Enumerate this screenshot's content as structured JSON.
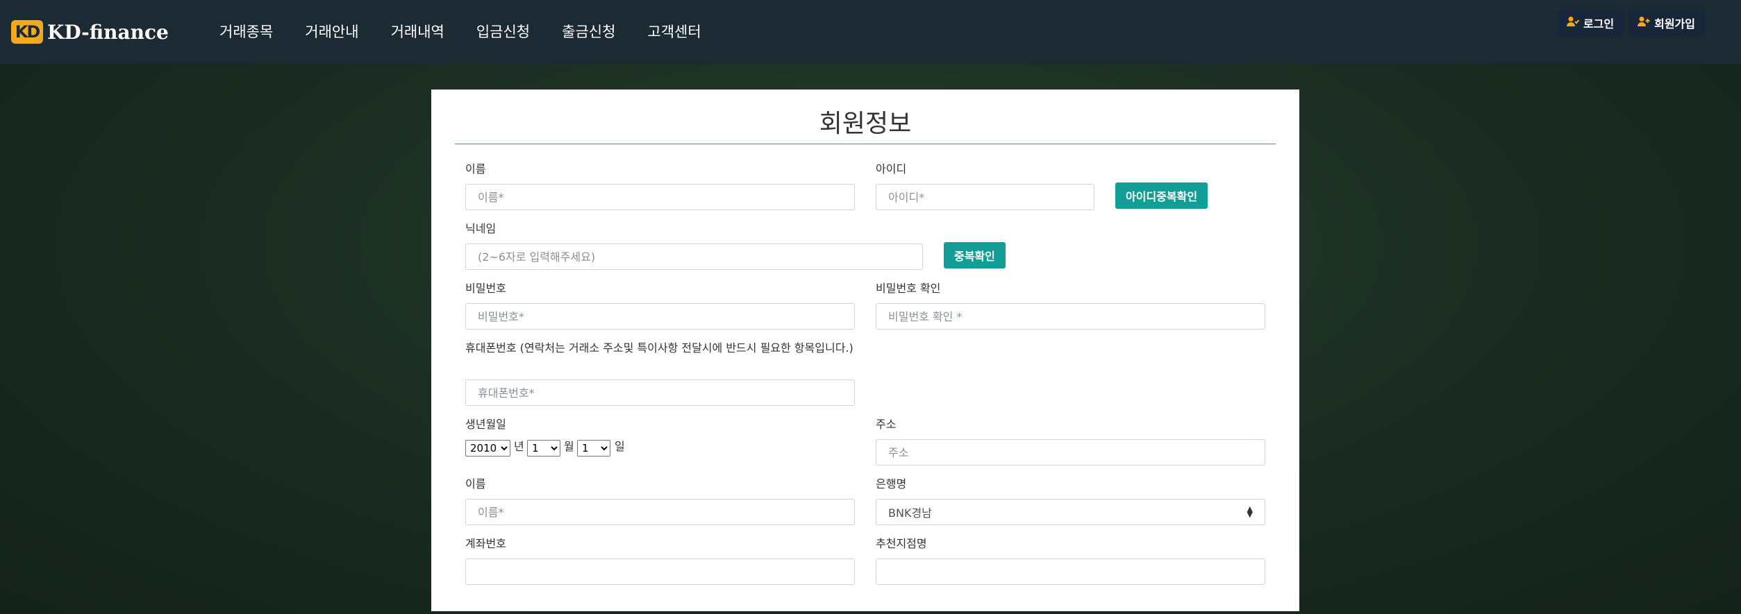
{
  "header": {
    "logo_mark": "KD",
    "logo_text": "KD-finance",
    "nav": [
      "거래종목",
      "거래안내",
      "거래내역",
      "입금신청",
      "출금신청",
      "고객센터"
    ],
    "login_label": "로그인",
    "signup_label": "회원가입"
  },
  "page": {
    "card_title": "회원정보"
  },
  "form": {
    "name_label": "이름",
    "name_placeholder": "이름*",
    "id_label": "아이디",
    "id_placeholder": "아이디*",
    "id_check_button": "아이디중복확인",
    "nickname_label": "닉네임",
    "nickname_placeholder": "(2~6자로 입력해주세요)",
    "nickname_check_button": "중복확인",
    "password_label": "비밀번호",
    "password_placeholder": "비밀번호*",
    "password_confirm_label": "비밀번호 확인",
    "password_confirm_placeholder": "비밀번호 확인 *",
    "phone_label": "휴대폰번호 (연락처는 거래소 주소및 특이사항 전달시에 반드시 필요한 항목입니다.)",
    "phone_placeholder": "휴대폰번호*",
    "birth_label": "생년월일",
    "birth_year": "2010",
    "birth_year_unit": "년",
    "birth_month": "1",
    "birth_month_unit": "월",
    "birth_day": "1",
    "birth_day_unit": "일",
    "address_label": "주소",
    "address_placeholder": "주소",
    "holder_label": "이름",
    "holder_placeholder": "이름*",
    "bank_label": "은행명",
    "bank_value": "BNK경남",
    "account_label": "계좌번호",
    "branch_label": "추천지점명"
  },
  "colors": {
    "accent": "#129e96",
    "logo": "#f5a91c",
    "header_bg": "#1c2a33"
  }
}
